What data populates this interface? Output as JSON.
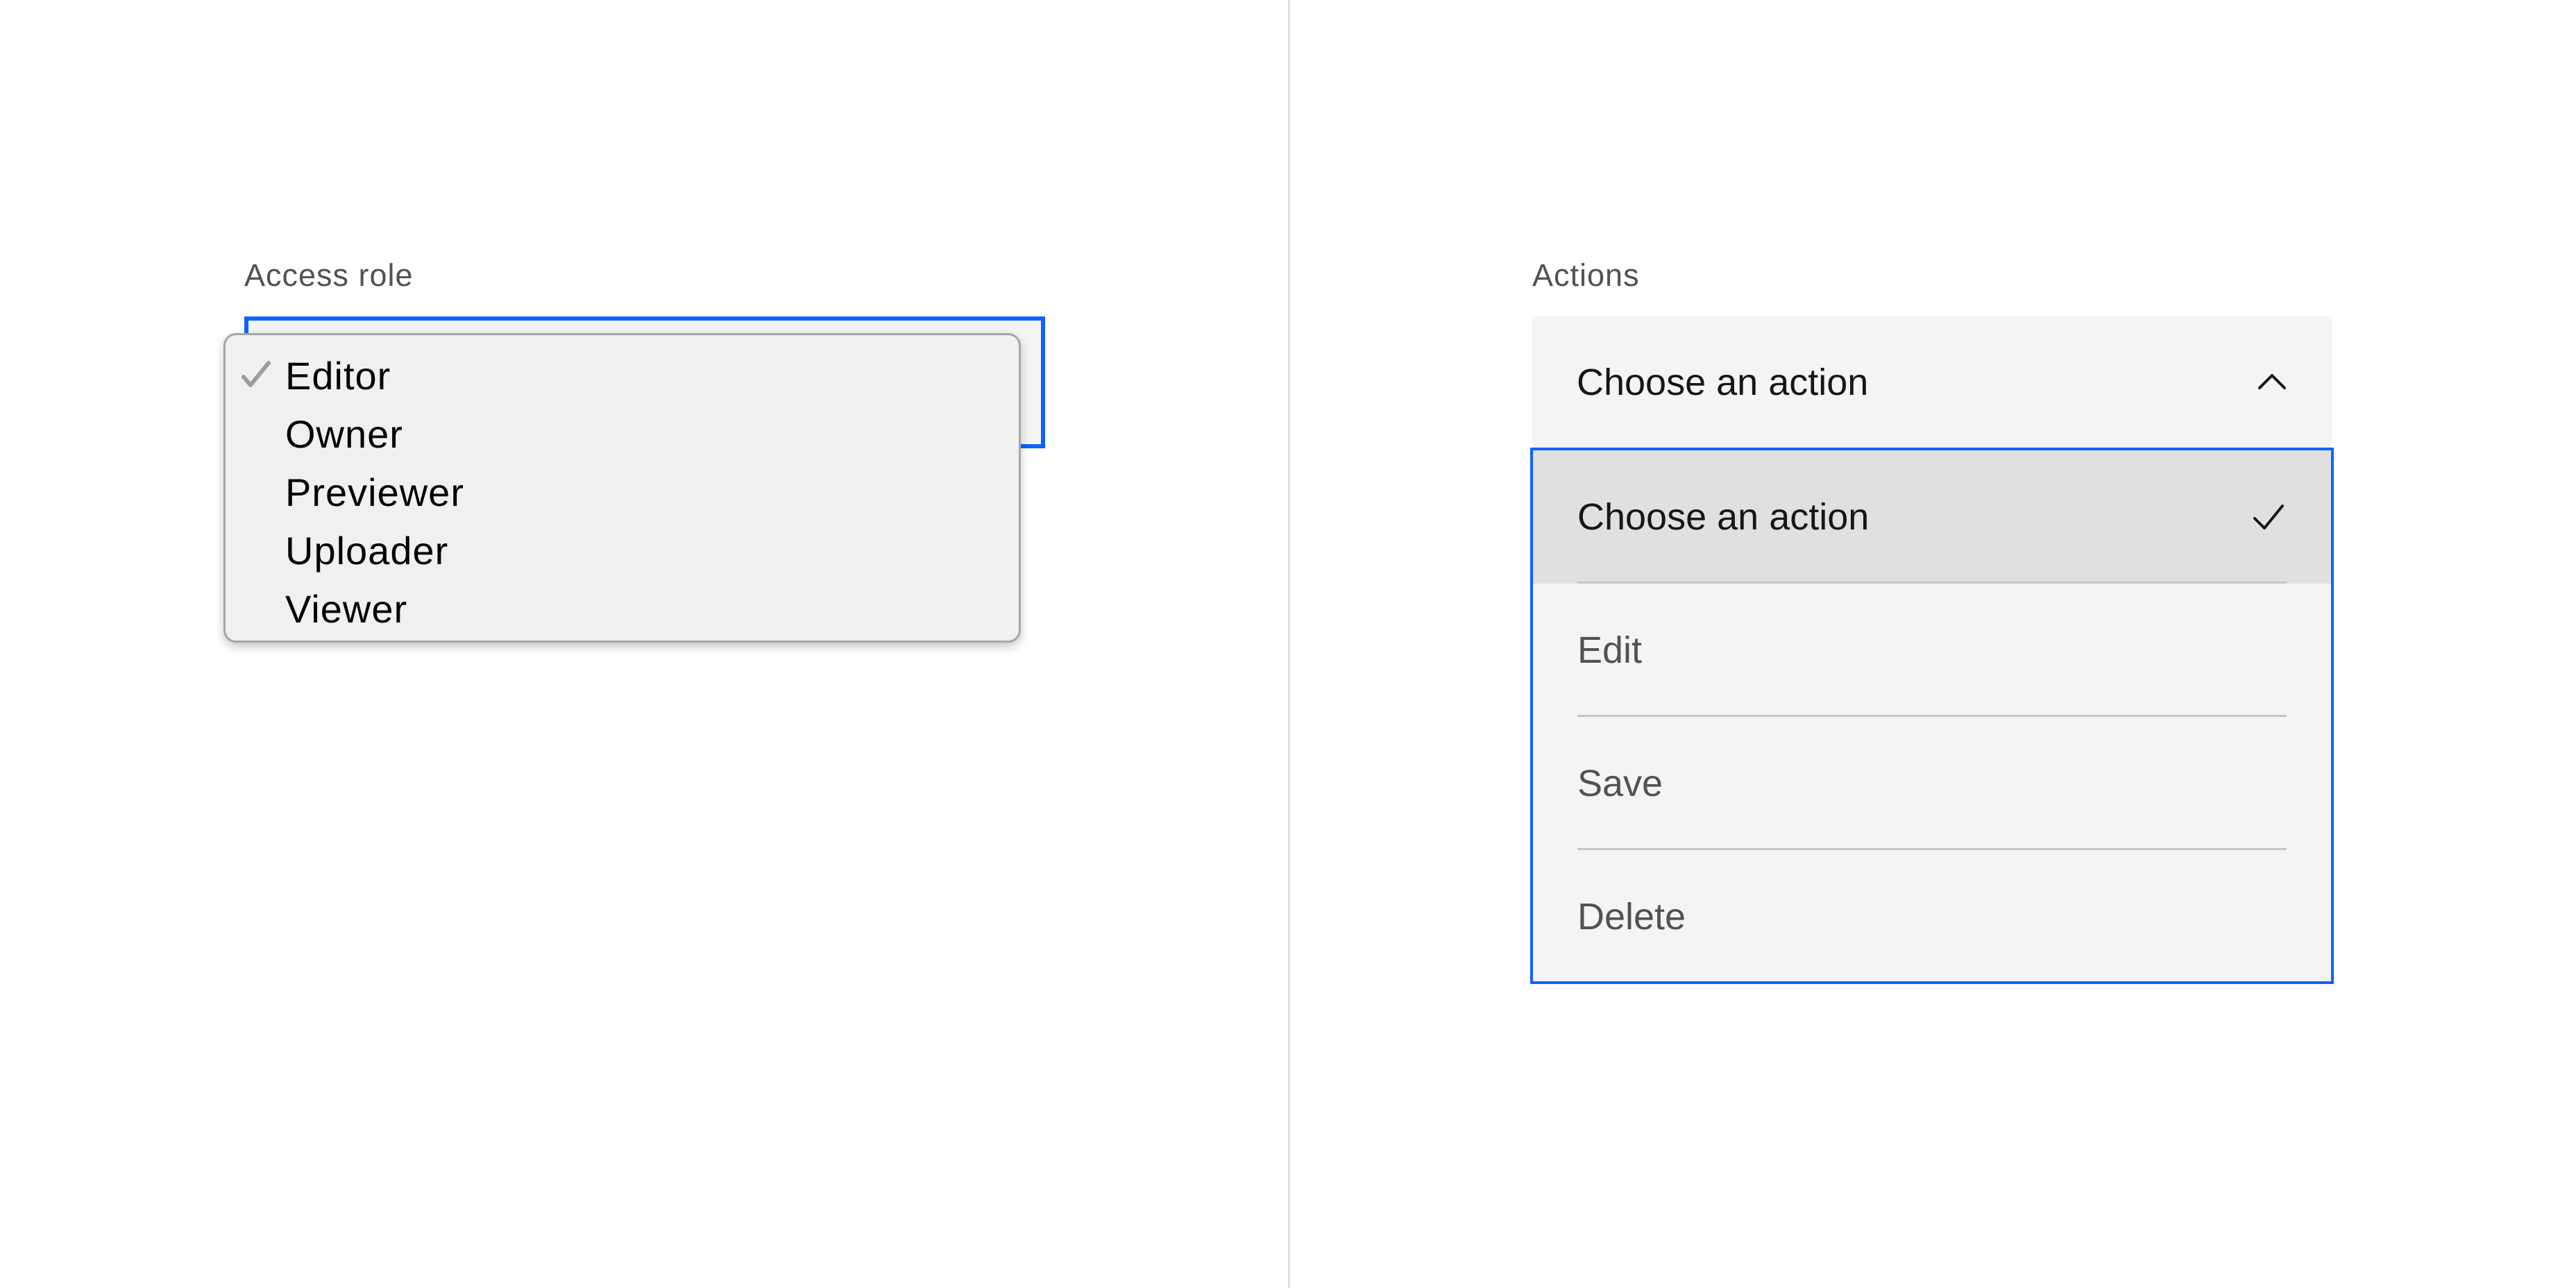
{
  "left_panel": {
    "label": "Access role",
    "options": [
      {
        "label": "Editor",
        "selected": true
      },
      {
        "label": "Owner",
        "selected": false
      },
      {
        "label": "Previewer",
        "selected": false
      },
      {
        "label": "Uploader",
        "selected": false
      },
      {
        "label": "Viewer",
        "selected": false
      }
    ]
  },
  "right_panel": {
    "label": "Actions",
    "field_value": "Choose an action",
    "items": [
      {
        "label": "Choose an action",
        "selected": true
      },
      {
        "label": "Edit",
        "selected": false
      },
      {
        "label": "Save",
        "selected": false
      },
      {
        "label": "Delete",
        "selected": false
      }
    ]
  },
  "colors": {
    "focus": "#0f62fe",
    "field_bg": "#f4f4f4",
    "selected_bg": "#e0e0e0",
    "separator": "#c6c6c6",
    "native_menu_bg": "#f0f0f0"
  },
  "icons": {
    "native_check": "checkmark-icon",
    "chevron": "chevron-up-icon",
    "item_check": "checkmark-icon"
  }
}
